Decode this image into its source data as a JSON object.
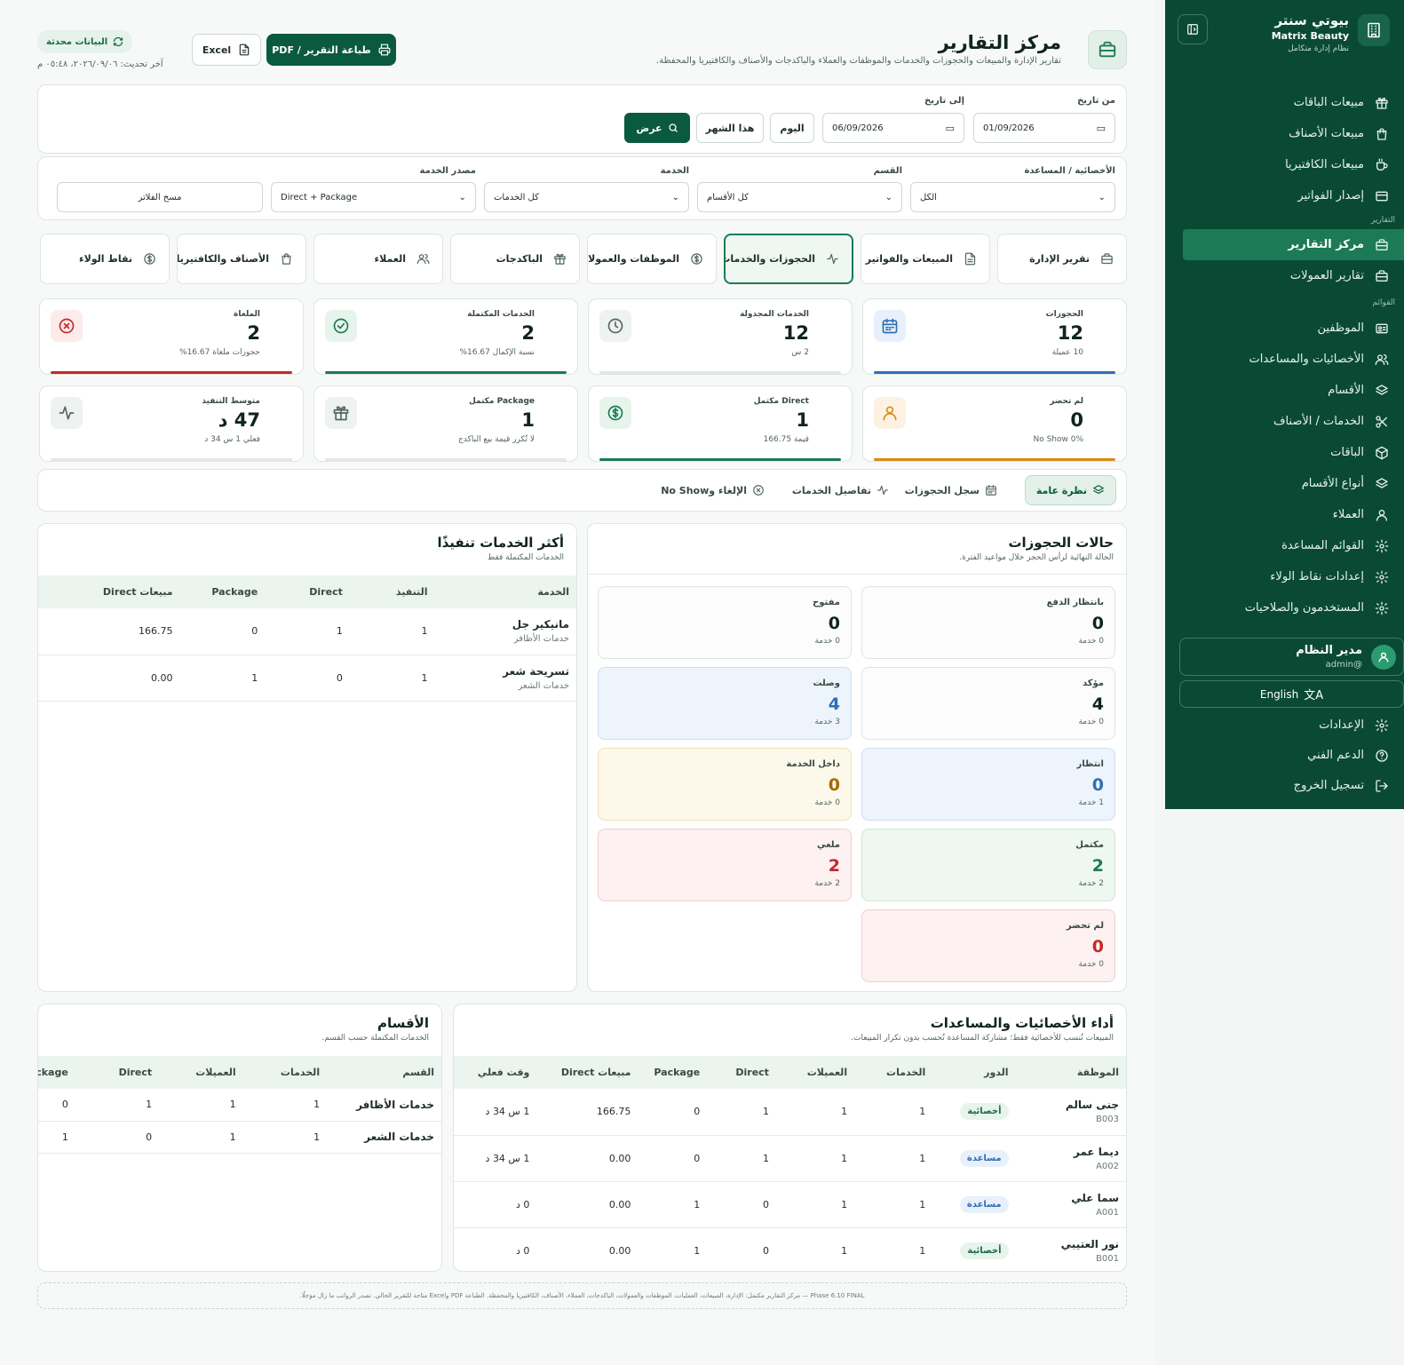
{
  "sidebar": {
    "brand_name": "بيوتي سنتر",
    "brand_sub": "Matrix Beauty",
    "brand_tag": "نظام إدارة متكامل",
    "items_top": [
      {
        "label": "مبيعات الباقات",
        "icon": "gift-icon"
      },
      {
        "label": "مبيعات الأصناف",
        "icon": "bag-icon"
      },
      {
        "label": "مبيعات الكافتيريا",
        "icon": "coffee-icon"
      },
      {
        "label": "إصدار الفواتير",
        "icon": "card-icon"
      }
    ],
    "section_reports": "التقارير",
    "items_reports": [
      {
        "label": "مركز التقارير",
        "icon": "briefcase-icon",
        "active": true
      },
      {
        "label": "تقارير العمولات",
        "icon": "briefcase-icon"
      }
    ],
    "section_lists": "القوائم",
    "items_lists": [
      {
        "label": "الموظفين",
        "icon": "id-card-icon"
      },
      {
        "label": "الأخصائيات والمساعدات",
        "icon": "users-icon"
      },
      {
        "label": "الأقسام",
        "icon": "layers-icon"
      },
      {
        "label": "الخدمات / الأصناف",
        "icon": "scissors-icon"
      },
      {
        "label": "الباقات",
        "icon": "box-icon"
      },
      {
        "label": "أنواع الأقسام",
        "icon": "layers-icon"
      },
      {
        "label": "العملاء",
        "icon": "user-icon"
      },
      {
        "label": "القوائم المساعدة",
        "icon": "gear-icon"
      },
      {
        "label": "إعدادات نقاط الولاء",
        "icon": "gear-icon"
      },
      {
        "label": "المستخدمون والصلاحيات",
        "icon": "gear-icon"
      }
    ],
    "user_name": "مدير النظام",
    "user_handle": "@admin",
    "language": "English",
    "bottom": [
      {
        "label": "الإعدادات",
        "icon": "gear-icon"
      },
      {
        "label": "الدعم الفني",
        "icon": "help-icon"
      },
      {
        "label": "تسجيل الخروج",
        "icon": "logout-icon"
      }
    ]
  },
  "header": {
    "title": "مركز التقارير",
    "subtitle": "تقارير الإدارة والمبيعات والحجوزات والخدمات والموظفات والعملاء والباكدجات والأصناف والكافتيريا والمحفظة.",
    "print_button": "طباعة التقرير / PDF",
    "excel_button": "Excel",
    "updated_badge": "البيانات محدثة",
    "last_update": "آخر تحديث: ٢٠٢٦/٠٩/٠٦، ٠٥:٤٨ م"
  },
  "filters": {
    "from_label": "من تاريخ",
    "from_value": "01/09/2026",
    "to_label": "إلى تاريخ",
    "to_value": "06/09/2026",
    "today": "اليوم",
    "this_month": "هذا الشهر",
    "show": "عرض",
    "specialist_label": "الأخصائية / المساعدة",
    "specialist_value": "الكل",
    "department_label": "القسم",
    "department_value": "كل الأقسام",
    "service_label": "الخدمة",
    "service_value": "كل الخدمات",
    "source_label": "مصدر الخدمة",
    "source_value": "Direct + Package",
    "clear": "مسح الفلاتر"
  },
  "report_tabs": [
    {
      "label": "تقرير الإدارة",
      "icon": "briefcase-icon"
    },
    {
      "label": "المبيعات والفواتير",
      "icon": "document-icon"
    },
    {
      "label": "الحجوزات والخدمات",
      "icon": "activity-icon",
      "active": true
    },
    {
      "label": "الموظفات والعمولات",
      "icon": "dollar-icon"
    },
    {
      "label": "الباكدجات",
      "icon": "gift-icon"
    },
    {
      "label": "العملاء",
      "icon": "users-icon"
    },
    {
      "label": "الأصناف والكافتيريا والمحفظة",
      "icon": "bag-icon"
    },
    {
      "label": "نقاط الولاء",
      "icon": "dollar-icon"
    }
  ],
  "kpis": [
    {
      "label": "الحجوزات",
      "value": "12",
      "sub": "10 عميلة",
      "icon": "calendar-icon",
      "color": "#2f6fb3"
    },
    {
      "label": "الخدمات المجدولة",
      "value": "12",
      "sub": "2 س",
      "icon": "clock-icon",
      "color": "#e3e8e5"
    },
    {
      "label": "الخدمات المكتملة",
      "value": "2",
      "sub": "نسبة الإكمال 16.67%",
      "icon": "check-circle-icon",
      "color": "#1c7a57"
    },
    {
      "label": "الملغاة",
      "value": "2",
      "sub": "حجوزات ملغاة 16.67%",
      "icon": "x-circle-icon",
      "color": "#c62828"
    },
    {
      "label": "لم تحضر",
      "value": "0",
      "sub": "No Show 0%",
      "icon": "user-icon",
      "color": "#d98a1a"
    },
    {
      "label": "Direct مكتمل",
      "value": "1",
      "sub": "قيمة 166.75",
      "icon": "dollar-icon",
      "color": "#1c7a57"
    },
    {
      "label": "Package مكتمل",
      "value": "1",
      "sub": "لا تُكرر قيمة بيع الباكدج",
      "icon": "gift-icon",
      "color": "#e3e8e5"
    },
    {
      "label": "متوسط التنفيذ",
      "value": "47 د",
      "sub": "فعلي 1 س 34 د",
      "icon": "activity-icon",
      "color": "#e3e8e5"
    }
  ],
  "sub_tabs": [
    {
      "label": "نظرة عامة",
      "icon": "layers-icon",
      "active": true
    },
    {
      "label": "سجل الحجوزات",
      "icon": "calendar-icon"
    },
    {
      "label": "تفاصيل الخدمات",
      "icon": "activity-icon"
    },
    {
      "label": "الإلغاء وNo Show",
      "icon": "x-circle-icon"
    }
  ],
  "statuses": {
    "title": "حالات الحجوزات",
    "subtitle": "الحالة النهائية لرأس الحجز خلال مواعيد الفترة.",
    "items": [
      {
        "label": "بانتظار الدفع",
        "value": "0",
        "sub": "0 خدمة",
        "bg": "#fbfcfb",
        "border": "#dde6e1",
        "color": "#10241c"
      },
      {
        "label": "مفتوح",
        "value": "0",
        "sub": "0 خدمة",
        "bg": "#fbfcfb",
        "border": "#dde6e1",
        "color": "#10241c"
      },
      {
        "label": "مؤكد",
        "value": "4",
        "sub": "0 خدمة",
        "bg": "#fbfcfb",
        "border": "#dde6e1",
        "color": "#10241c"
      },
      {
        "label": "وصلت",
        "value": "4",
        "sub": "3 خدمة",
        "bg": "#eef4fc",
        "border": "#cfdff2",
        "color": "#2f6fb3"
      },
      {
        "label": "انتظار",
        "value": "0",
        "sub": "1 خدمة",
        "bg": "#eef4fc",
        "border": "#cfdff2",
        "color": "#2f6fb3"
      },
      {
        "label": "داخل الخدمة",
        "value": "0",
        "sub": "0 خدمة",
        "bg": "#fdf9ea",
        "border": "#efe2b2",
        "color": "#a36a00"
      },
      {
        "label": "مكتمل",
        "value": "2",
        "sub": "2 خدمة",
        "bg": "#eff7f2",
        "border": "#cfe6d8",
        "color": "#1c7a57"
      },
      {
        "label": "ملغي",
        "value": "2",
        "sub": "2 خدمة",
        "bg": "#fdf1f1",
        "border": "#f0cfcf",
        "color": "#c62828"
      },
      {
        "label": "لم تحضر",
        "value": "0",
        "sub": "0 خدمة",
        "bg": "#fdf1f1",
        "border": "#f0cfcf",
        "color": "#c62828"
      }
    ]
  },
  "top_services": {
    "title": "أكثر الخدمات تنفيذًا",
    "subtitle": "الخدمات المكتملة فقط",
    "columns": [
      "الخدمة",
      "التنفيذ",
      "Direct",
      "Package",
      "مبيعات Direct"
    ],
    "rows": [
      {
        "name": "مانيكير جل",
        "dept": "خدمات الأظافر",
        "exec": "1",
        "direct": "1",
        "package": "0",
        "sales": "166.75"
      },
      {
        "name": "تسريحة شعر",
        "dept": "خدمات الشعر",
        "exec": "1",
        "direct": "0",
        "package": "1",
        "sales": "0.00"
      }
    ]
  },
  "staff_perf": {
    "title": "أداء الأخصائيات والمساعدات",
    "subtitle": "المبيعات تُنسب للأخصائية فقط؛ مشاركة المساعدة تُحسب بدون تكرار المبيعات.",
    "columns": [
      "الموظفة",
      "الدور",
      "الخدمات",
      "العميلات",
      "Direct",
      "Package",
      "مبيعات Direct",
      "وقت فعلي"
    ],
    "rows": [
      {
        "name": "جنى سالم",
        "code": "B003",
        "role": "أخصائية",
        "role_type": "spec",
        "services": "1",
        "clients": "1",
        "direct": "1",
        "package": "0",
        "sales": "166.75",
        "time": "1 س 34 د"
      },
      {
        "name": "ديما عمر",
        "code": "A002",
        "role": "مساعدة",
        "role_type": "asst",
        "services": "1",
        "clients": "1",
        "direct": "1",
        "package": "0",
        "sales": "0.00",
        "time": "1 س 34 د"
      },
      {
        "name": "سما علي",
        "code": "A001",
        "role": "مساعدة",
        "role_type": "asst",
        "services": "1",
        "clients": "1",
        "direct": "0",
        "package": "1",
        "sales": "0.00",
        "time": "0 د"
      },
      {
        "name": "نور العتيبي",
        "code": "B001",
        "role": "أخصائية",
        "role_type": "spec",
        "services": "1",
        "clients": "1",
        "direct": "0",
        "package": "1",
        "sales": "0.00",
        "time": "0 د"
      }
    ]
  },
  "departments": {
    "title": "الأقسام",
    "subtitle": "الخدمات المكتملة حسب القسم.",
    "columns": [
      "القسم",
      "الخدمات",
      "العميلات",
      "Direct",
      "Package"
    ],
    "rows": [
      {
        "name": "خدمات الأظافر",
        "services": "1",
        "clients": "1",
        "direct": "1",
        "package": "0"
      },
      {
        "name": "خدمات الشعر",
        "services": "1",
        "clients": "1",
        "direct": "0",
        "package": "1"
      }
    ]
  },
  "footer": "Phase 6.10 FINAL — مركز التقارير مكتمل: الإدارة، المبيعات، العمليات، الموظفات والعمولات، الباكدجات، العملاء، الأصناف، الكافتيريا والمحفظة. الطباعة PDF وExcel متاحة للتقرير الحالي. تصدر الرواتب ما زال مؤجلًا."
}
